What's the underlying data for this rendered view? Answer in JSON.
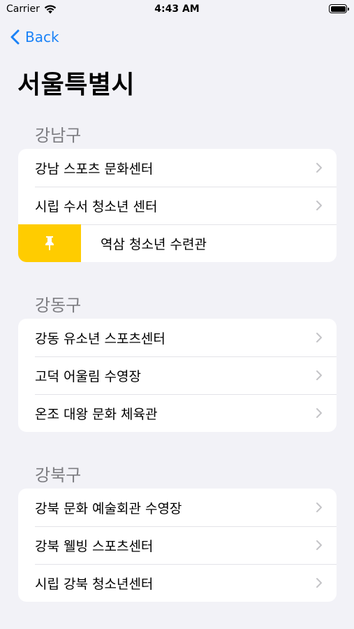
{
  "status_bar": {
    "carrier": "Carrier",
    "time": "4:43 AM"
  },
  "nav": {
    "back_label": "Back"
  },
  "title": "서울특별시",
  "sections": [
    {
      "header": "강남구",
      "rows": [
        "강남 스포츠 문화센터",
        "시립 수서 청소년 센터",
        "역삼 청소년 수련관"
      ]
    },
    {
      "header": "강동구",
      "rows": [
        "강동 유소년 스포츠센터",
        "고덕 어울림 수영장",
        "온조 대왕 문화 체육관"
      ]
    },
    {
      "header": "강북구",
      "rows": [
        "강북 문화 예술회관 수영장",
        "강북 웰빙 스포츠센터",
        "시립 강북 청소년센터"
      ]
    }
  ],
  "colors": {
    "accent": "#1a82f7",
    "pin_action": "#ffcc00",
    "background": "#f2f2f7"
  }
}
